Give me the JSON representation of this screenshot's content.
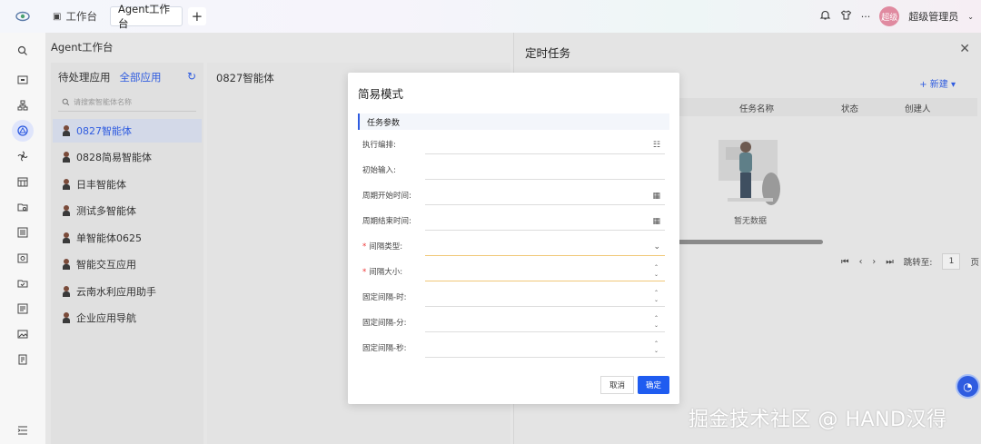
{
  "topbar": {
    "tabs": [
      {
        "label": "工作台",
        "icon": "workspace-icon"
      },
      {
        "label": "Agent工作台",
        "active": true
      }
    ],
    "user_name": "超级管理员",
    "avatar_text": "超级"
  },
  "breadcrumb": "Agent工作台",
  "sidepanel": {
    "tabs": [
      "待处理应用",
      "全部应用"
    ],
    "active_tab": "全部应用",
    "search_placeholder": "请搜索智能体名称",
    "agents": [
      "0827智能体",
      "0828简易智能体",
      "日丰智能体",
      "测试多智能体",
      "单智能体0625",
      "智能交互应用",
      "云南水利应用助手",
      "企业应用导航"
    ],
    "selected": "0827智能体"
  },
  "main": {
    "title": "0827智能体"
  },
  "drawer": {
    "title": "定时任务",
    "new_label": "新建",
    "columns": [
      "任务名称",
      "状态",
      "创建人"
    ],
    "empty_text": "暂无数据",
    "pager": {
      "jump_label": "跳转至:",
      "page": "1",
      "page_suffix": "页"
    }
  },
  "modal": {
    "title": "简易模式",
    "section": "任务参数",
    "fields": [
      {
        "label": "执行编排:",
        "required": false,
        "control": "list"
      },
      {
        "label": "初始输入:",
        "required": false,
        "control": "none"
      },
      {
        "label": "周期开始时间:",
        "required": false,
        "control": "date"
      },
      {
        "label": "周期结束时间:",
        "required": false,
        "control": "date"
      },
      {
        "label": "间隔类型:",
        "required": true,
        "control": "select"
      },
      {
        "label": "间隔大小:",
        "required": true,
        "control": "stepper"
      },
      {
        "label": "固定间隔-时:",
        "required": false,
        "control": "stepper"
      },
      {
        "label": "固定间隔-分:",
        "required": false,
        "control": "stepper"
      },
      {
        "label": "固定间隔-秒:",
        "required": false,
        "control": "stepper"
      }
    ],
    "cancel_label": "取消",
    "ok_label": "确定"
  },
  "credit": "掘金技术社区 @ HAND汉得",
  "colors": {
    "accent": "#2f5ce0",
    "primary_button": "#1f5cf0"
  }
}
